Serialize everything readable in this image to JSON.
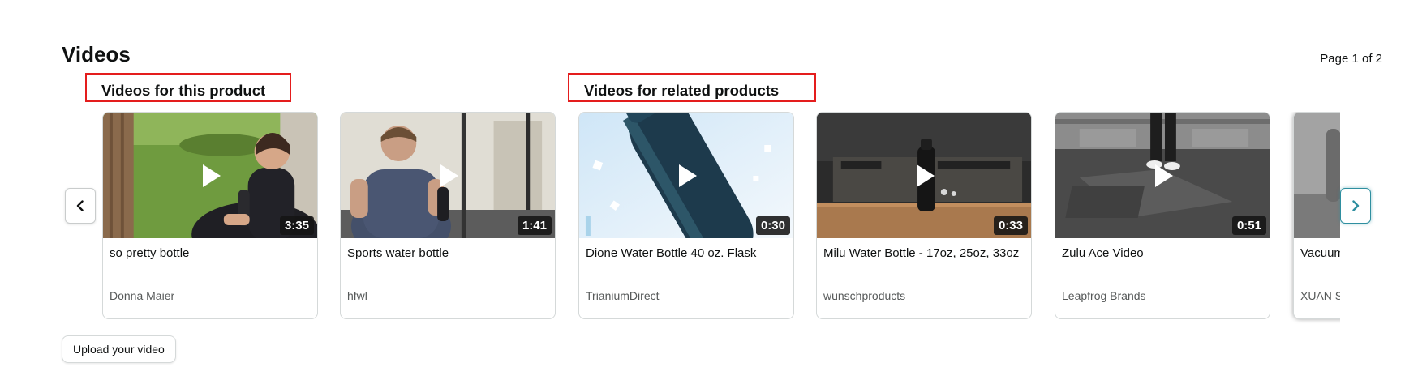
{
  "header": {
    "title": "Videos",
    "page_indicator": "Page 1 of 2"
  },
  "sections": {
    "this_product": "Videos for this product",
    "related_products": "Videos for related products"
  },
  "videos": [
    {
      "title": "so pretty bottle",
      "channel": "Donna Maier",
      "duration": "3:35"
    },
    {
      "title": "Sports water bottle",
      "channel": "hfwl",
      "duration": "1:41"
    },
    {
      "title": "Dione Water Bottle 40 oz. Flask",
      "channel": "TrianiumDirect",
      "duration": "0:30"
    },
    {
      "title": "Milu Water Bottle - 17oz, 25oz, 33oz",
      "channel": "wunschproducts",
      "duration": "0:33"
    },
    {
      "title": "Zulu Ace Video",
      "channel": "Leapfrog Brands",
      "duration": "0:51"
    },
    {
      "title": "Vacuum Insulated Water Bottle,Wide Mouth",
      "channel": "XUAN SHUN",
      "duration": ""
    }
  ],
  "controls": {
    "prev_icon": "chevron-left-icon",
    "next_icon": "chevron-right-icon",
    "play_icon": "play-icon",
    "upload_label": "Upload your video"
  },
  "colors": {
    "highlight_border": "#e41d1d",
    "next_button_accent": "#2f8fa0"
  }
}
